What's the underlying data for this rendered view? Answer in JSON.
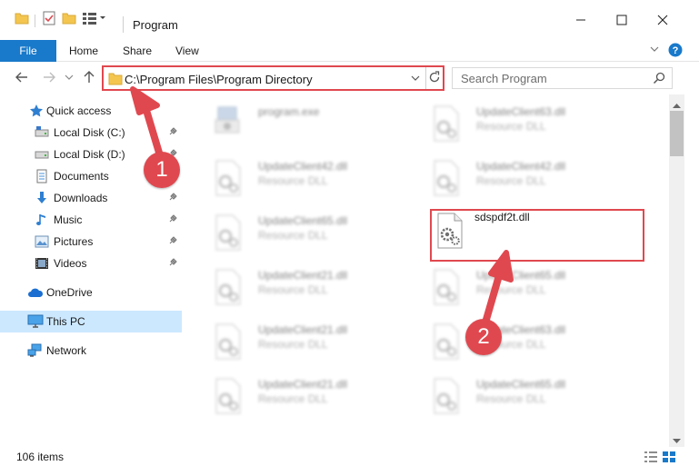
{
  "window": {
    "title": "Program",
    "controls": {
      "minimize": "minimize-icon",
      "maximize": "maximize-icon",
      "close": "close-icon"
    }
  },
  "ribbon": {
    "tabs": [
      {
        "label": "File",
        "active": true
      },
      {
        "label": "Home"
      },
      {
        "label": "Share"
      },
      {
        "label": "View"
      }
    ]
  },
  "address": {
    "path": "C:\\Program Files\\Program Directory"
  },
  "search": {
    "placeholder": "Search Program"
  },
  "sidebar": {
    "items": [
      {
        "label": "Quick access",
        "icon": "star-icon"
      },
      {
        "label": "Local Disk (C:)",
        "icon": "drive-icon",
        "pinned": true
      },
      {
        "label": "Local Disk (D:)",
        "icon": "drive-icon",
        "pinned": true
      },
      {
        "label": "Documents",
        "icon": "documents-icon",
        "pinned": true
      },
      {
        "label": "Downloads",
        "icon": "download-icon",
        "pinned": true
      },
      {
        "label": "Music",
        "icon": "music-icon",
        "pinned": true
      },
      {
        "label": "Pictures",
        "icon": "pictures-icon",
        "pinned": true
      },
      {
        "label": "Videos",
        "icon": "videos-icon",
        "pinned": true
      },
      {
        "label": "OneDrive",
        "icon": "cloud-icon"
      },
      {
        "label": "This PC",
        "icon": "computer-icon",
        "selected": true
      },
      {
        "label": "Network",
        "icon": "network-icon"
      }
    ]
  },
  "files": [
    {
      "name": "program.exe",
      "type": ""
    },
    {
      "name": "UpdateClient63.dll",
      "type": "Resource DLL"
    },
    {
      "name": "UpdateClient42.dll",
      "type": "Resource DLL"
    },
    {
      "name": "UpdateClient42.dll",
      "type": "Resource DLL"
    },
    {
      "name": "UpdateClient65.dll",
      "type": "Resource DLL"
    },
    {
      "name": "sdspdf2t.dll",
      "type": ""
    },
    {
      "name": "UpdateClient21.dll",
      "type": "Resource DLL"
    },
    {
      "name": "UpdateClient65.dll",
      "type": "Resource DLL"
    },
    {
      "name": "UpdateClient21.dll",
      "type": "Resource DLL"
    },
    {
      "name": "UpdateClient63.dll",
      "type": "Resource DLL"
    },
    {
      "name": "UpdateClient21.dll",
      "type": "Resource DLL"
    },
    {
      "name": "UpdateClient65.dll",
      "type": "Resource DLL"
    }
  ],
  "status": {
    "items_count": "106 items"
  },
  "annotations": {
    "step1": "1",
    "step2": "2",
    "color": "#e0484f"
  },
  "colors": {
    "accent": "#1979ca",
    "selected": "#cce8ff",
    "annotation": "#e0484f"
  }
}
